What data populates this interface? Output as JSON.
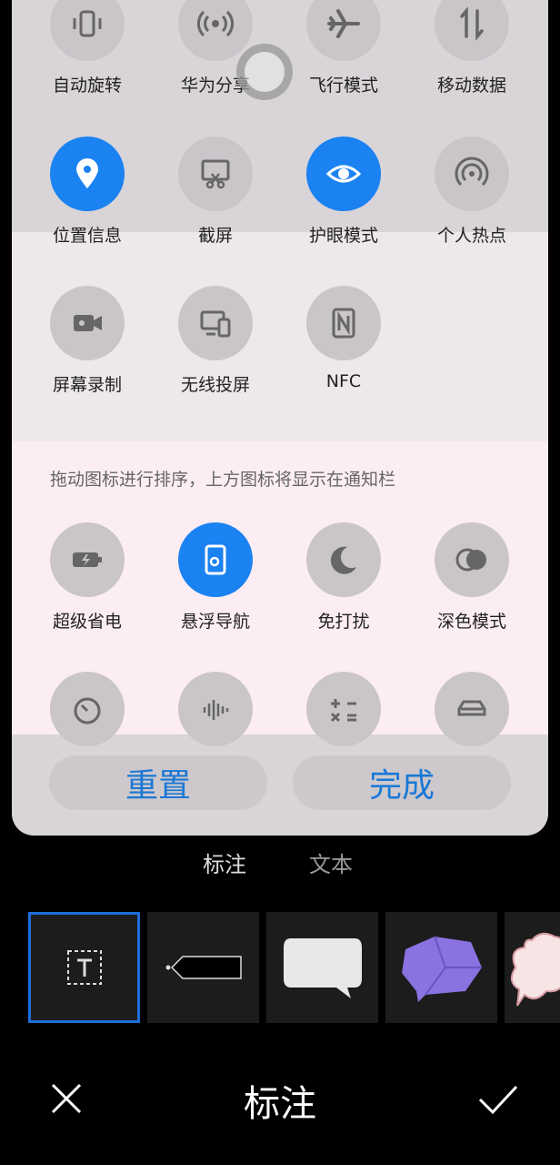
{
  "toggles_row1": [
    {
      "label": "自动旋转",
      "icon": "rotate-icon",
      "on": false
    },
    {
      "label": "华为分享",
      "icon": "share-wave-icon",
      "on": false
    },
    {
      "label": "飞行模式",
      "icon": "airplane-icon",
      "on": false
    },
    {
      "label": "移动数据",
      "icon": "mobile-data-icon",
      "on": false
    }
  ],
  "toggles_row2": [
    {
      "label": "位置信息",
      "icon": "location-icon",
      "on": true
    },
    {
      "label": "截屏",
      "icon": "screenshot-icon",
      "on": false
    },
    {
      "label": "护眼模式",
      "icon": "eye-icon",
      "on": true
    },
    {
      "label": "个人热点",
      "icon": "hotspot-icon",
      "on": false
    }
  ],
  "toggles_row3": [
    {
      "label": "屏幕录制",
      "icon": "video-record-icon",
      "on": false
    },
    {
      "label": "无线投屏",
      "icon": "cast-screen-icon",
      "on": false
    },
    {
      "label": "NFC",
      "icon": "nfc-icon",
      "on": false
    }
  ],
  "hint_text": "拖动图标进行排序，上方图标将显示在通知栏",
  "toggles_row4": [
    {
      "label": "超级省电",
      "icon": "battery-saver-icon",
      "on": false
    },
    {
      "label": "悬浮导航",
      "icon": "float-nav-icon",
      "on": true
    },
    {
      "label": "免打扰",
      "icon": "moon-icon",
      "on": false
    },
    {
      "label": "深色模式",
      "icon": "dark-mode-icon",
      "on": false
    }
  ],
  "toggles_row5_icons": [
    "timer-icon",
    "sound-wave-icon",
    "calculator-icon",
    "car-icon"
  ],
  "buttons": {
    "reset": "重置",
    "done": "完成"
  },
  "editor": {
    "tabs": [
      {
        "label": "标注",
        "active": true
      },
      {
        "label": "文本",
        "active": false
      }
    ],
    "title": "标注",
    "thumbs": [
      "text-box-icon",
      "tag-shape-icon",
      "speech-bubble-icon",
      "gem-bubble-icon",
      "cloud-bubble-icon"
    ]
  },
  "colors": {
    "accent": "#1a82f1",
    "button_text": "#1a78d6",
    "selected_outline": "#1e6fd9"
  }
}
